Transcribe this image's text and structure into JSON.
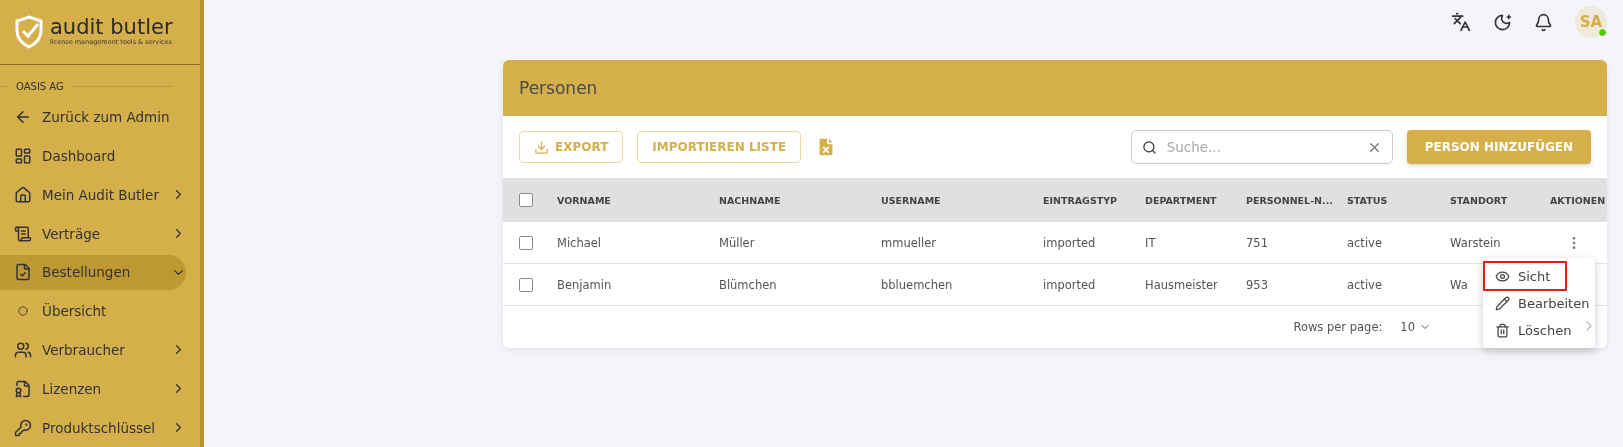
{
  "sidebar": {
    "logo": {
      "name": "audit butler",
      "tagline": "license management tools & services"
    },
    "section": "OASIS AG",
    "items": [
      {
        "kind": "back",
        "label": "Zurück zum Admin"
      },
      {
        "kind": "link",
        "label": "Dashboard"
      },
      {
        "kind": "group",
        "label": "Mein Audit Butler",
        "expanded": false,
        "selected": false
      },
      {
        "kind": "group",
        "label": "Verträge",
        "expanded": false,
        "selected": false
      },
      {
        "kind": "group",
        "label": "Bestellungen",
        "expanded": true,
        "selected": true
      },
      {
        "kind": "sub",
        "label": "Übersicht"
      },
      {
        "kind": "group",
        "label": "Verbraucher",
        "expanded": false,
        "selected": false
      },
      {
        "kind": "group",
        "label": "Lizenzen",
        "expanded": false,
        "selected": false
      },
      {
        "kind": "group",
        "label": "Produktschlüssel",
        "expanded": false,
        "selected": false
      }
    ]
  },
  "topbar": {
    "avatar": "SA",
    "online": true
  },
  "card": {
    "title": "Personen",
    "export": "EXPORT",
    "import": "IMPORTIEREN LISTE",
    "search": {
      "placeholder": "Suche..."
    },
    "add": "PERSON HINZUFÜGEN",
    "table": {
      "all_checked": false,
      "columns": [
        "VORNAME",
        "NACHNAME",
        "USERNAME",
        "EINTRAGSTYP",
        "DEPARTMENT",
        "PERSONNEL-N...",
        "STATUS",
        "STANDORT",
        "AKTIONEN"
      ],
      "rows": [
        {
          "checked": false,
          "cells": [
            "Michael",
            "Müller",
            "mmueller",
            "imported",
            "IT",
            "751",
            "active",
            "Warstein"
          ]
        },
        {
          "checked": false,
          "cells": [
            "Benjamin",
            "Blümchen",
            "bbluemchen",
            "imported",
            "Hausmeister",
            "953",
            "active",
            "Wa"
          ]
        }
      ]
    },
    "pagination": {
      "label": "Rows per page:",
      "value": "10"
    }
  },
  "menu": [
    {
      "label": "Sicht",
      "selected": true
    },
    {
      "label": "Bearbeiten",
      "selected": false
    },
    {
      "label": "Löschen",
      "selected": false
    }
  ]
}
